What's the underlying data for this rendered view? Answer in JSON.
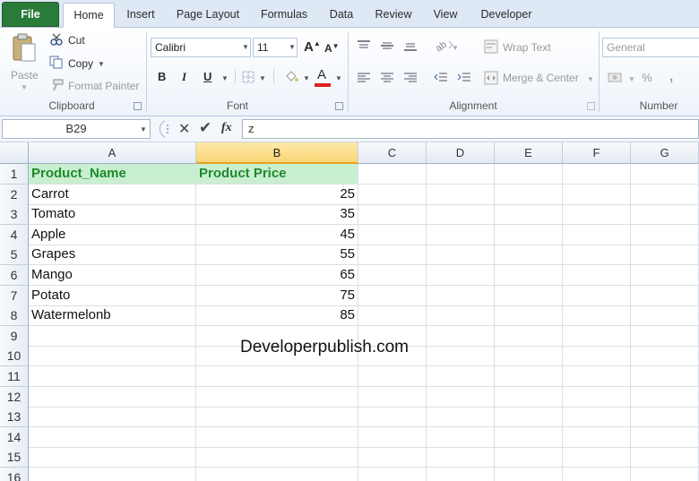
{
  "tabs": [
    "File",
    "Home",
    "Insert",
    "Page Layout",
    "Formulas",
    "Data",
    "Review",
    "View",
    "Developer"
  ],
  "clipboard": {
    "paste": "Paste",
    "cut": "Cut",
    "copy": "Copy",
    "format_painter": "Format Painter",
    "group_label": "Clipboard"
  },
  "font": {
    "name": "Calibri",
    "size": "11",
    "bold": "B",
    "italic": "I",
    "underline": "U",
    "color_glyph": "A",
    "group_label": "Font"
  },
  "alignment": {
    "wrap_text": "Wrap Text",
    "merge_center": "Merge & Center",
    "group_label": "Alignment"
  },
  "number": {
    "format": "General",
    "percent": "%",
    "comma": ",",
    "group_label": "Number"
  },
  "formula_bar": {
    "name_box": "B29",
    "fx": "fx",
    "value": "z"
  },
  "columns": [
    "A",
    "B",
    "C",
    "D",
    "E",
    "F",
    "G"
  ],
  "selected_column": "B",
  "rows": [
    "1",
    "2",
    "3",
    "4",
    "5",
    "6",
    "7",
    "8",
    "9",
    "10",
    "11",
    "12",
    "13",
    "14",
    "15",
    "16"
  ],
  "table": {
    "headers": [
      "Product_Name",
      "Product Price"
    ],
    "data": [
      [
        "Carrot",
        "25"
      ],
      [
        "Tomato",
        "35"
      ],
      [
        "Apple",
        "45"
      ],
      [
        "Grapes",
        "55"
      ],
      [
        "Mango",
        "65"
      ],
      [
        "Potato",
        "75"
      ],
      [
        "Watermelonb",
        "85"
      ]
    ]
  },
  "watermark": "Developerpublish.com",
  "colors": {
    "header_fill": "#c9efd1",
    "header_text": "#1f8a2b",
    "file_tab": "#2a7a3a",
    "selected_col_header": "#f9d576"
  }
}
